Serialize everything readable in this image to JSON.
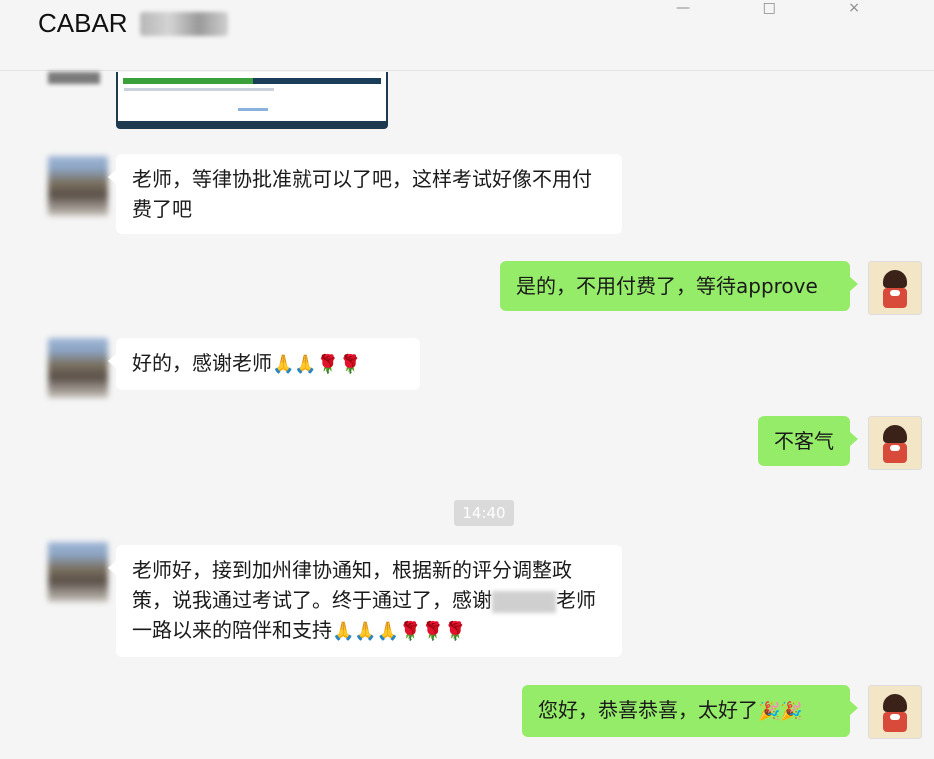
{
  "header": {
    "title": "CABAR",
    "window_controls": "— □ ×"
  },
  "messages": [
    {
      "side": "left",
      "text": "老师，等律协批准就可以了吧，这样考试好像不用付费了吧"
    },
    {
      "side": "right",
      "text": "是的，不用付费了，等待approve"
    },
    {
      "side": "left",
      "text": "好的，感谢老师",
      "emoji": "🙏🙏🌹🌹"
    },
    {
      "side": "right",
      "text": "不客气"
    },
    {
      "side": "left",
      "text_part1": "老师好，接到加州律协通知，根据新的评分调整政策，说我通过考试了。终于通过了，感谢",
      "text_part2": "老师一路以来的陪伴和支持",
      "emoji": "🙏🙏🙏🌹🌹🌹"
    },
    {
      "side": "right",
      "text": "您好，恭喜恭喜，太好了",
      "emoji": "🎉🎉"
    }
  ],
  "timestamp": "14:40",
  "colors": {
    "bubble_self": "#95ec69",
    "bubble_other": "#ffffff",
    "background": "#f5f5f5"
  }
}
